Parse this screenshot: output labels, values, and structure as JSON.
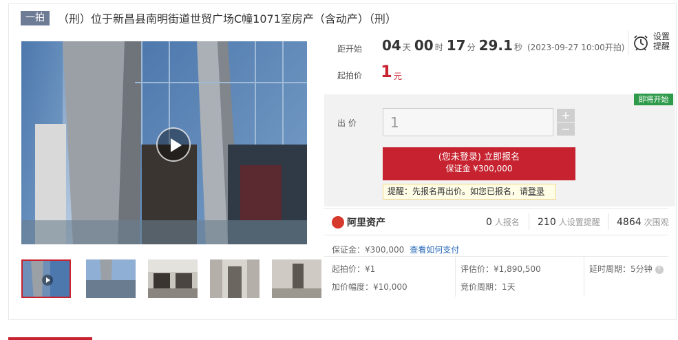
{
  "header": {
    "round_badge": "一拍",
    "title": "（刑）位于新昌县南明街道世贸广场C幢1071室房产（含动产）（刑）"
  },
  "countdown": {
    "label": "距开始",
    "days": "04",
    "days_unit": "天",
    "hours": "00",
    "hours_unit": "时",
    "minutes": "17",
    "minutes_unit": "分",
    "seconds": "29.1",
    "seconds_unit": "秒",
    "start_note": "(2023-09-27 10:00开拍)"
  },
  "starting_price": {
    "label": "起拍价",
    "value": "1",
    "unit": "元"
  },
  "reminder": {
    "label": "设置提醒",
    "icon": "alarm-clock-icon"
  },
  "bid": {
    "label": "出 价",
    "input_value": "1",
    "plus": "+",
    "minus": "−",
    "status_badge": "即将开始",
    "signup_line1": "(您未登录) 立即报名",
    "signup_line2": "保证金 ¥300,000",
    "tip_text": "提醒：先报名再出价。如您已报名，请",
    "tip_link": "登录"
  },
  "platform": {
    "logo_text": "阿里资产",
    "logo_icon": "ali-asset-logo-icon"
  },
  "stats": {
    "signups": "0",
    "signups_label": "人报名",
    "reminders": "210",
    "reminders_label": "人设置提醒",
    "views": "4864",
    "views_label": "次围观"
  },
  "info": {
    "deposit": "保证金：¥300,000",
    "pay_link": "查看如何支付",
    "start_price": "起拍价：¥1",
    "appraisal": "评估价：¥1,890,500",
    "delay": "延时周期：5分钟",
    "increment": "加价幅度：¥10,000",
    "cycle": "竞价周期：1天",
    "help_icon": "question-icon",
    "help_glyph": "?"
  },
  "gallery": {
    "play_icon": "play-icon",
    "thumbnail_count": 5
  },
  "colors": {
    "accent": "#c6222f",
    "badge": "#6d7b94",
    "status_green": "#2e9b4a",
    "link_blue": "#2a6ab8"
  }
}
